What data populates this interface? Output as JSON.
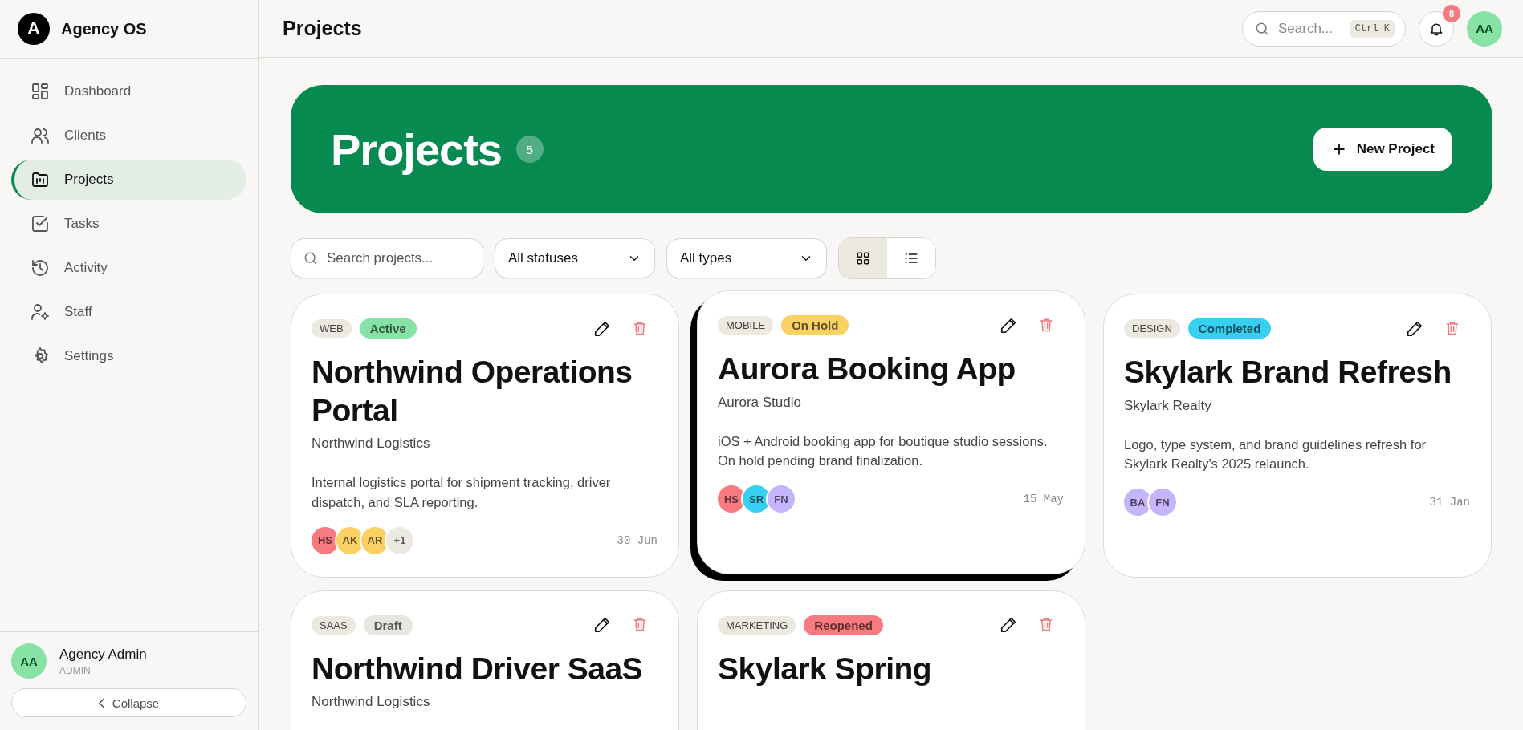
{
  "brand": {
    "logo_letter": "A",
    "name": "Agency OS"
  },
  "sidebar": {
    "items": [
      {
        "label": "Dashboard",
        "selected": false
      },
      {
        "label": "Clients",
        "selected": false
      },
      {
        "label": "Projects",
        "selected": true
      },
      {
        "label": "Tasks",
        "selected": false
      },
      {
        "label": "Activity",
        "selected": false
      },
      {
        "label": "Staff",
        "selected": false
      },
      {
        "label": "Settings",
        "selected": false
      }
    ],
    "user": {
      "initials": "AA",
      "name": "Agency Admin",
      "role": "ADMIN"
    },
    "collapse": "Collapse"
  },
  "header": {
    "title": "Projects",
    "search": {
      "placeholder": "Search...",
      "shortcut": "Ctrl K"
    },
    "notifications": "8",
    "avatar": "AA"
  },
  "hero": {
    "title": "Projects",
    "count": "5",
    "button": "New Project"
  },
  "filters": {
    "search": {
      "placeholder": "Search projects..."
    },
    "status": "All statuses",
    "type": "All types",
    "views": [
      {
        "kind": "grid",
        "selected": true
      },
      {
        "kind": "list",
        "selected": false
      }
    ]
  },
  "projects": [
    {
      "type": "WEB",
      "status": {
        "label": "Active",
        "color": "#86e3a5"
      },
      "hovered": false,
      "title": "Northwind Operations Portal",
      "client": "Northwind Logistics",
      "description": "Internal logistics portal for shipment tracking, driver dispatch, and SLA reporting.",
      "members": [
        {
          "initials": "HS",
          "color": "#f87a80"
        },
        {
          "initials": "AK",
          "color": "#fcd163"
        },
        {
          "initials": "AR",
          "color": "#fcd163"
        },
        {
          "initials": "+1",
          "color": "#ece9e3"
        }
      ],
      "date": "30 Jun"
    },
    {
      "type": "MOBILE",
      "status": {
        "label": "On Hold",
        "color": "#fcd163"
      },
      "hovered": true,
      "title": "Aurora Booking App",
      "client": "Aurora Studio",
      "description": "iOS + Android booking app for boutique studio sessions. On hold pending brand finalization.",
      "members": [
        {
          "initials": "HS",
          "color": "#f87a80"
        },
        {
          "initials": "SR",
          "color": "#38d0f0"
        },
        {
          "initials": "FN",
          "color": "#c4b5fd"
        }
      ],
      "date": "15 May"
    },
    {
      "type": "DESIGN",
      "status": {
        "label": "Completed",
        "color": "#38d0f0"
      },
      "hovered": false,
      "title": "Skylark Brand Refresh",
      "client": "Skylark Realty",
      "description": "Logo, type system, and brand guidelines refresh for Skylark Realty's 2025 relaunch.",
      "members": [
        {
          "initials": "BA",
          "color": "#c4b5fd"
        },
        {
          "initials": "FN",
          "color": "#c4b5fd"
        }
      ],
      "date": "31 Jan"
    },
    {
      "type": "SAAS",
      "status": {
        "label": "Draft",
        "color": "#e8e6e2"
      },
      "hovered": false,
      "title": "Northwind Driver SaaS",
      "client": "Northwind Logistics"
    },
    {
      "type": "MARKETING",
      "status": {
        "label": "Reopened",
        "color": "#f87a80"
      },
      "hovered": false,
      "title": "Skylark Spring"
    }
  ]
}
